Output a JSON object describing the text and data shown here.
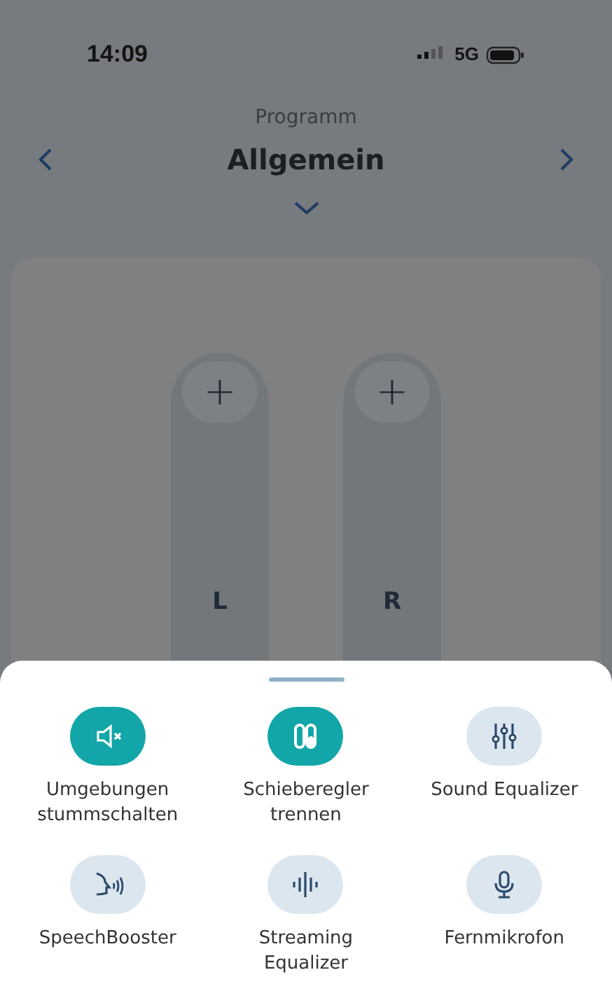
{
  "status_bar": {
    "time": "14:09",
    "network": "5G"
  },
  "header": {
    "caption": "Programm",
    "title": "Allgemein"
  },
  "sliders": [
    {
      "plus": "+",
      "label": "L",
      "level": 0
    },
    {
      "plus": "+",
      "label": "R",
      "level": 0
    }
  ],
  "actions": [
    {
      "kind": "mute",
      "label": "Umgebungen stummschalten",
      "on": true
    },
    {
      "kind": "split",
      "label": "Schieberegler trennen",
      "on": true
    },
    {
      "kind": "equalizer",
      "label": "Sound Equalizer",
      "on": false
    },
    {
      "kind": "speech",
      "label": "SpeechBooster",
      "on": false
    },
    {
      "kind": "wave",
      "label": "Streaming Equalizer",
      "on": false
    },
    {
      "kind": "mic",
      "label": "Fernmikrofon",
      "on": false
    }
  ]
}
